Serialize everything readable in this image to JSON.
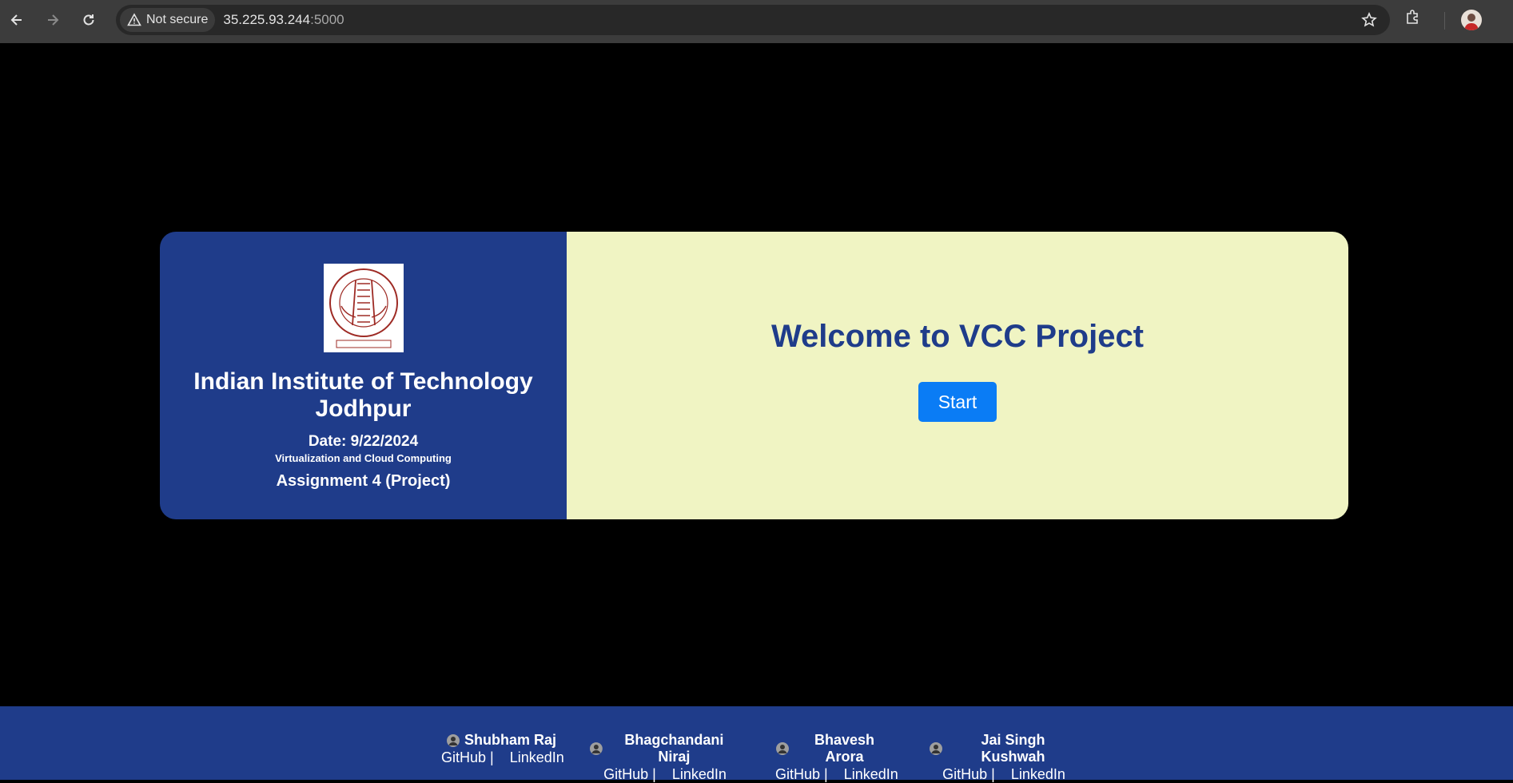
{
  "browser": {
    "security_label": "Not secure",
    "url_host": "35.225.93.244",
    "url_port": ":5000"
  },
  "left_panel": {
    "institute": "Indian Institute of Technology Jodhpur",
    "date": "Date: 9/22/2024",
    "course": "Virtualization and Cloud Computing",
    "assignment": "Assignment 4 (Project)"
  },
  "right_panel": {
    "welcome": "Welcome to VCC Project",
    "start_label": "Start"
  },
  "footer": {
    "members": [
      {
        "name": "Shubham Raj",
        "github": "GitHub |",
        "linkedin": "LinkedIn"
      },
      {
        "name": "Bhagchandani Niraj",
        "github": "GitHub |",
        "linkedin": "LinkedIn"
      },
      {
        "name": "Bhavesh Arora",
        "github": "GitHub |",
        "linkedin": "LinkedIn"
      },
      {
        "name": "Jai Singh Kushwah",
        "github": "GitHub |",
        "linkedin": "LinkedIn"
      }
    ]
  },
  "colors": {
    "panel_blue": "#1f3c8a",
    "panel_cream": "#f0f4c3",
    "button_blue": "#0a7cf5"
  }
}
